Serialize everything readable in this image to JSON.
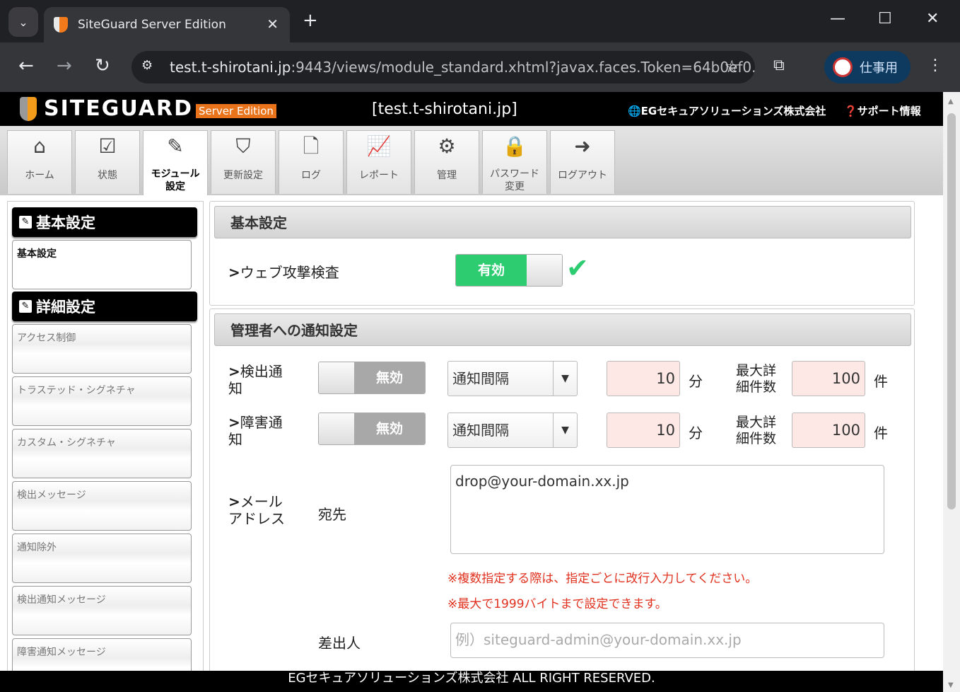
{
  "browser": {
    "tab_title": "SiteGuard Server Edition",
    "url_host": "test.t-shirotani.jp",
    "url_path": ":9443/views/module_standard.xhtml?javax.faces.Token=64b0ef0...",
    "profile_label": "仕事用"
  },
  "header": {
    "logo_text": "SITEGUARD",
    "edition": "Server Edition",
    "site": "[test.t-shirotani.jp]",
    "company_link": "🌐EGセキュアソリューションズ株式会社",
    "support_link": "❓サポート情報"
  },
  "nav": [
    {
      "label": "ホーム",
      "icon": "home-icon"
    },
    {
      "label": "状態",
      "icon": "checkbox-icon"
    },
    {
      "label": "モジュール設定",
      "icon": "edit-icon"
    },
    {
      "label": "更新設定",
      "icon": "shield-icon"
    },
    {
      "label": "ログ",
      "icon": "file-icon"
    },
    {
      "label": "レポート",
      "icon": "chart-icon"
    },
    {
      "label": "管理",
      "icon": "gear-icon"
    },
    {
      "label": "パスワード変更",
      "icon": "lock-icon"
    },
    {
      "label": "ログアウト",
      "icon": "signout-icon"
    }
  ],
  "sidebar": {
    "section1": "基本設定",
    "section1_item": "基本設定",
    "section2": "詳細設定",
    "items": [
      "アクセス制御",
      "トラステッド・シグネチャ",
      "カスタム・シグネチャ",
      "検出メッセージ",
      "通知除外",
      "検出通知メッセージ",
      "障害通知メッセージ"
    ]
  },
  "basic": {
    "title": "基本設定",
    "web_label": "ウェブ攻撃検査",
    "web_state": "有効"
  },
  "notify": {
    "title": "管理者への通知設定",
    "detect_label": "検出通知",
    "fault_label": "障害通知",
    "off_state": "無効",
    "interval_select": "通知間隔",
    "detect_interval": "10",
    "fault_interval": "10",
    "minutes_unit": "分",
    "max_label": "最大詳細件数",
    "detect_max": "100",
    "fault_max": "100",
    "count_unit": "件",
    "mail_label": "メールアドレス",
    "to_label": "宛先",
    "to_value": "drop@your-domain.xx.jp",
    "note1": "※複数指定する際は、指定ごとに改行入力してください。",
    "note2": "※最大で1999バイトまで設定できます。",
    "from_label": "差出人",
    "from_placeholder": "例）siteguard-admin@your-domain.xx.jp"
  },
  "footer": "EGセキュアソリューションズ株式会社 ALL RIGHT RESERVED."
}
